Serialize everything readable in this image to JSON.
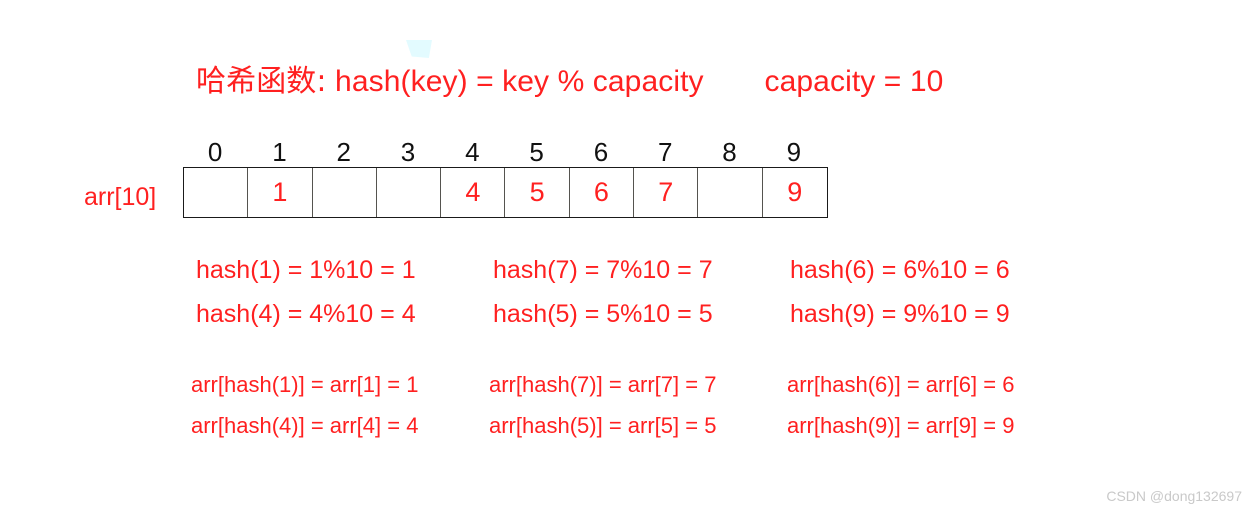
{
  "colors": {
    "accent_red": "#ff2020",
    "index_black": "#111111",
    "cell_border": "#55544f",
    "table_border": "#1a1a1a",
    "watermark_gray": "#c9c9c9",
    "artifact_cyan": "#e2fbff",
    "background": "#ffffff"
  },
  "title": {
    "label_cjk": "哈希函数:",
    "formula": "hash(key) = key % capacity",
    "capacity": "capacity = 10"
  },
  "array": {
    "name_label": "arr[10]",
    "indices": [
      "0",
      "1",
      "2",
      "3",
      "4",
      "5",
      "6",
      "7",
      "8",
      "9"
    ],
    "values": [
      "",
      "1",
      "",
      "",
      "4",
      "5",
      "6",
      "7",
      "",
      "9"
    ]
  },
  "hash_equations": [
    [
      "hash(1) = 1%10 = 1",
      "hash(7) = 7%10 = 7",
      "hash(6) = 6%10 = 6"
    ],
    [
      "hash(4) = 4%10 = 4",
      "hash(5) = 5%10 = 5",
      "hash(9) = 9%10 = 9"
    ]
  ],
  "arr_equations": [
    [
      "arr[hash(1)] = arr[1] = 1",
      "arr[hash(7)] = arr[7] = 7",
      "arr[hash(6)] = arr[6] = 6"
    ],
    [
      "arr[hash(4)] = arr[4] = 4",
      "arr[hash(5)] = arr[5] = 5",
      "arr[hash(9)] = arr[9] = 9"
    ]
  ],
  "watermark": "CSDN @dong132697"
}
